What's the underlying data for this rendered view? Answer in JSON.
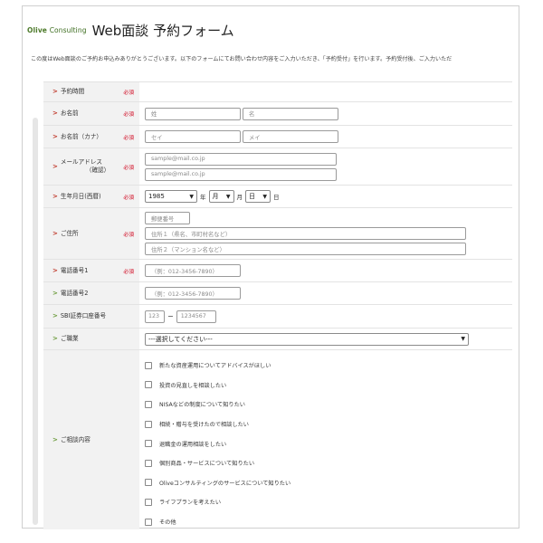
{
  "header": {
    "logo_brand": "Olive",
    "logo_rest": "Consulting",
    "title": "Web面談 予約フォーム"
  },
  "intro": "この度はWeb面談のご予約お申込みありがとうございます。以下のフォームにてお問い合わせ内容をご入力いただき、「予約受付」を行います。予約受付後、ご入力いただ",
  "required_label": "必須",
  "fields": {
    "reservation_time": {
      "label": "予約時間"
    },
    "name": {
      "label": "お名前",
      "last_placeholder": "姓",
      "first_placeholder": "名"
    },
    "name_kana": {
      "label": "お名前（カナ）",
      "last_placeholder": "セイ",
      "first_placeholder": "メイ"
    },
    "email": {
      "label": "メールアドレス",
      "confirm_label": "（確認）",
      "placeholder": "sample@mail.co.jp",
      "confirm_placeholder": "sample@mail.co.jp"
    },
    "birthdate": {
      "label": "生年月日(西暦)",
      "year_value": "1985",
      "year_unit": "年",
      "month_value": "月",
      "month_unit": "月",
      "day_value": "日",
      "day_unit": "日"
    },
    "address": {
      "label": "ご住所",
      "zip_placeholder": "郵便番号",
      "addr1_placeholder": "住所１（県名、市町村名など）",
      "addr2_placeholder": "住所２（マンション名など）"
    },
    "phone1": {
      "label": "電話番号1",
      "placeholder": "（例：012-3456-7890）"
    },
    "phone2": {
      "label": "電話番号2",
      "placeholder": "（例：012-3456-7890）"
    },
    "sbi": {
      "label": "SBI証券口座番号",
      "branch_placeholder": "123",
      "account_placeholder": "1234567",
      "separator": "−"
    },
    "occupation": {
      "label": "ご職業",
      "selected": "---選択してください---"
    },
    "consultation": {
      "label": "ご相談内容",
      "options": [
        "新たな資産運用についてアドバイスがほしい",
        "投資の見直しを相談したい",
        "NISAなどの制度について知りたい",
        "相続・贈与を受けたので相談したい",
        "退職金の運用相談をしたい",
        "個別商品・サービスについて知りたい",
        "Oliveコンサルティングのサービスについて知りたい",
        "ライフプランを考えたい",
        "その他"
      ]
    }
  }
}
